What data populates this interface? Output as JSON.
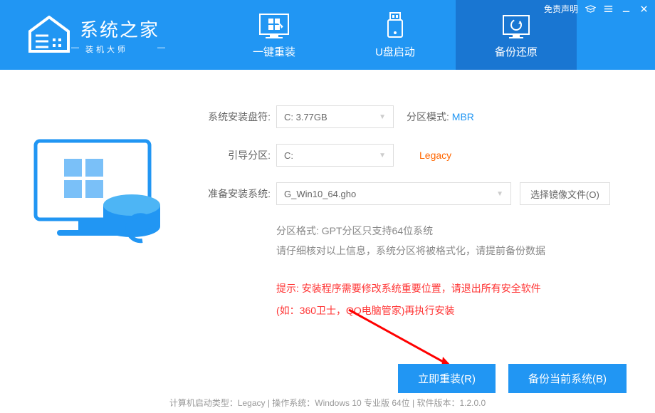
{
  "header": {
    "logo_main": "系统之家",
    "logo_sub": "装机大师",
    "disclaimer": "免责声明"
  },
  "tabs": {
    "reinstall": "一键重装",
    "usb": "U盘启动",
    "backup": "备份还原"
  },
  "form": {
    "drive_label": "系统安装盘符:",
    "drive_value": "C: 3.77GB",
    "partition_mode_label": "分区模式:",
    "partition_mode_value": "MBR",
    "boot_label": "引导分区:",
    "boot_value": "C:",
    "boot_type": "Legacy",
    "system_label": "准备安装系统:",
    "system_value": "G_Win10_64.gho",
    "browse_btn": "选择镜像文件(O)"
  },
  "info": {
    "line1": "分区格式:  GPT分区只支持64位系统",
    "line2": "请仔细核对以上信息，系统分区将被格式化，请提前备份数据"
  },
  "warning": {
    "line1": "提示:  安装程序需要修改系统重要位置，请退出所有安全软件",
    "line2": "(如：360卫士，QQ电脑管家)再执行安装"
  },
  "actions": {
    "reinstall": "立即重装(R)",
    "backup": "备份当前系统(B)"
  },
  "footer": "计算机启动类型：Legacy | 操作系统：Windows 10 专业版 64位 | 软件版本：1.2.0.0"
}
